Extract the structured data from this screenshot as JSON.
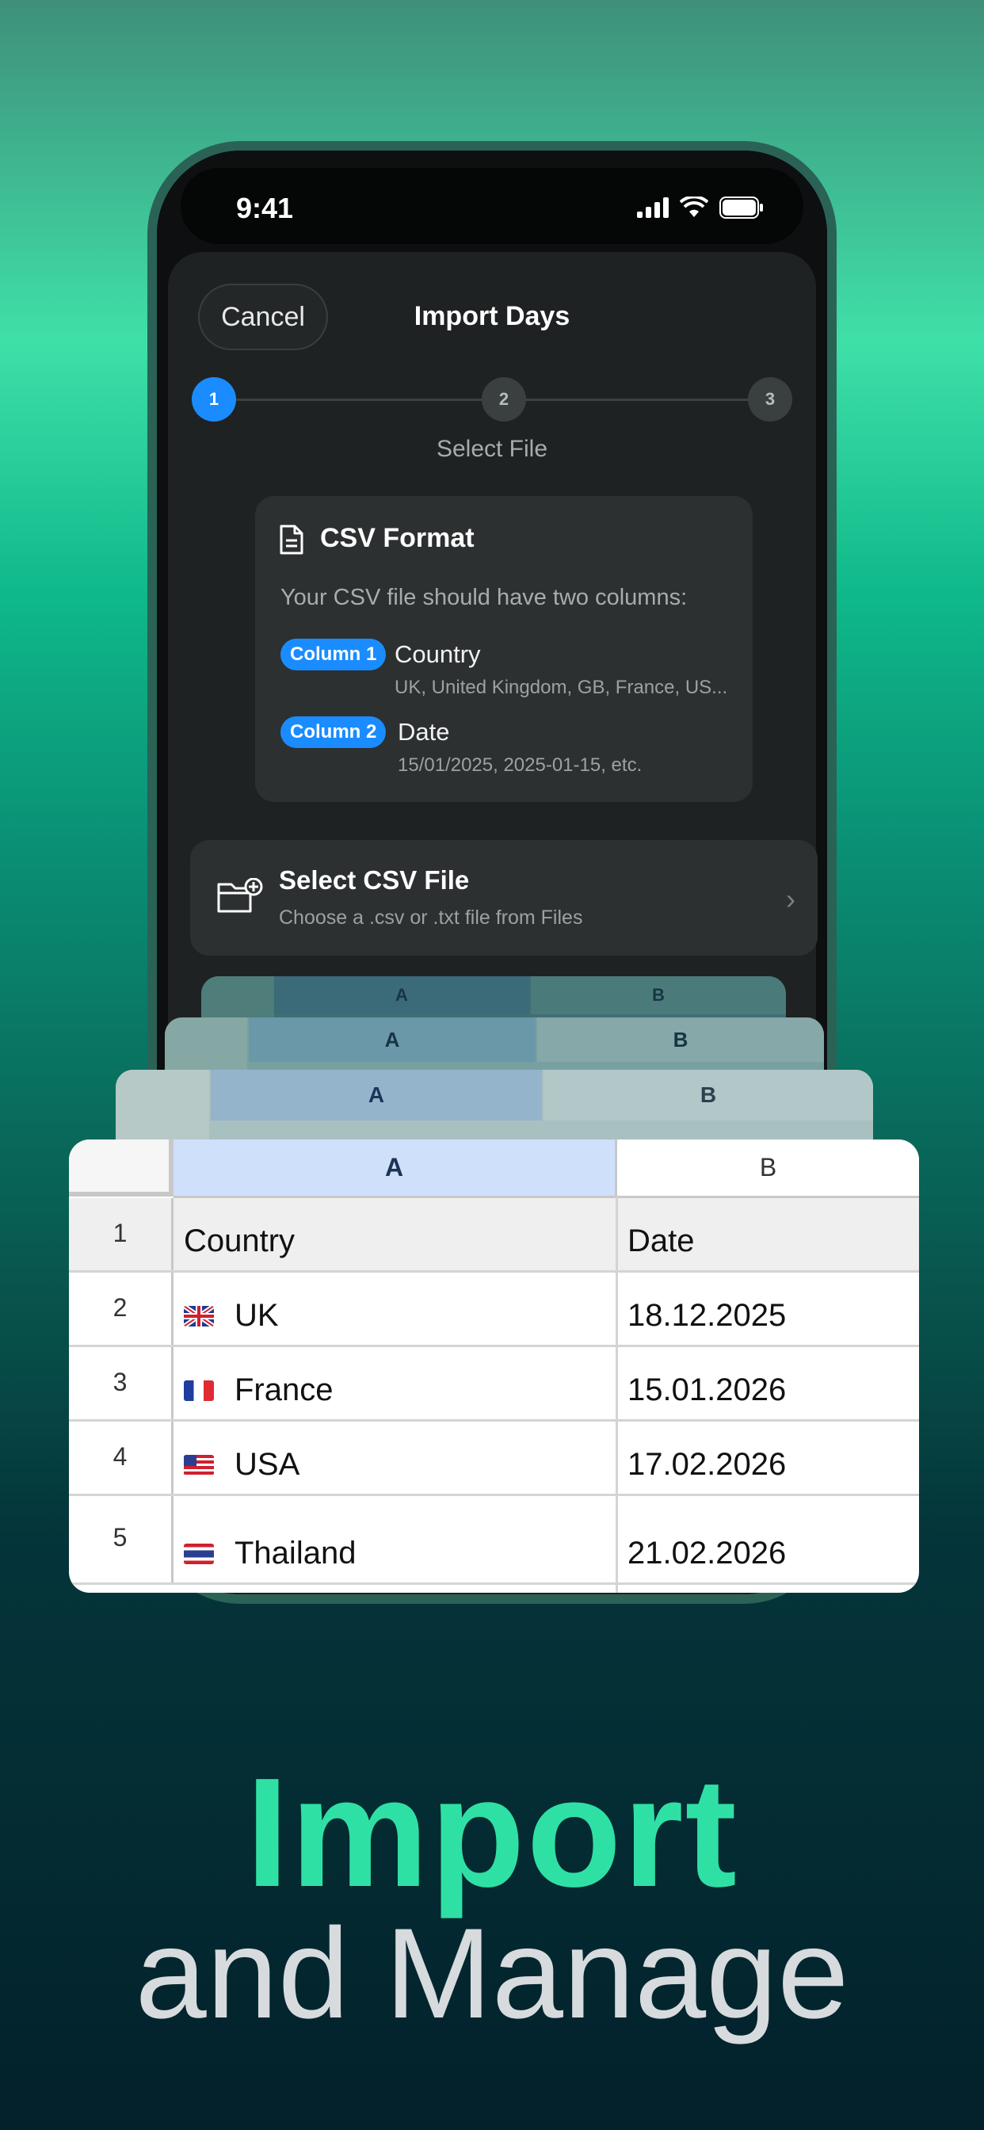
{
  "status": {
    "time": "9:41"
  },
  "sheet": {
    "cancel_label": "Cancel",
    "title": "Import Days",
    "steps": [
      "1",
      "2",
      "3"
    ],
    "step_label": "Select File"
  },
  "format_card": {
    "title": "CSV Format",
    "description": "Your CSV file should have two columns:",
    "columns": [
      {
        "badge": "Column 1",
        "name": "Country",
        "example": "UK, United Kingdom, GB, France, US..."
      },
      {
        "badge": "Column 2",
        "name": "Date",
        "example": "15/01/2025, 2025-01-15, etc."
      }
    ]
  },
  "select_file": {
    "title": "Select CSV File",
    "subtitle": "Choose a .csv or .txt file from Files"
  },
  "spreadsheet": {
    "col_a": "A",
    "col_b": "B",
    "rows": [
      {
        "num": "1",
        "a": "Country",
        "b": "Date",
        "flag": ""
      },
      {
        "num": "2",
        "a": "UK",
        "b": "18.12.2025",
        "flag": "uk-flag"
      },
      {
        "num": "3",
        "a": "France",
        "b": "15.01.2026",
        "flag": "france-flag"
      },
      {
        "num": "4",
        "a": "USA",
        "b": "17.02.2026",
        "flag": "usa-flag"
      },
      {
        "num": "5",
        "a": "Thailand",
        "b": "21.02.2026",
        "flag": "thailand-flag"
      }
    ]
  },
  "headline": {
    "line1": "Import",
    "line2": "and Manage"
  },
  "colors": {
    "accent": "#1a8cff",
    "headline": "#2fe0a4"
  }
}
